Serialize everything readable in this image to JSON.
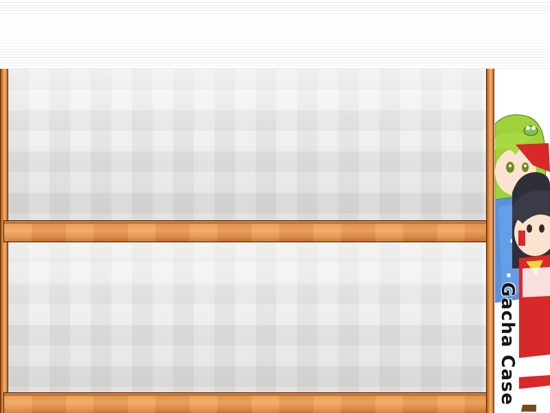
{
  "side_panel": {
    "title": "Gacha Case",
    "characters": [
      "green-haired-girl-icon",
      "shrine-maiden-girl-icon"
    ]
  },
  "shelves": [
    {
      "name": "upper-shelf",
      "items": []
    },
    {
      "name": "lower-shelf",
      "items": []
    }
  ],
  "colors": {
    "wood": "#f1a862",
    "wood_dark": "#3e1d06",
    "panel": "#f0f0f0",
    "header": "#ffffff"
  }
}
